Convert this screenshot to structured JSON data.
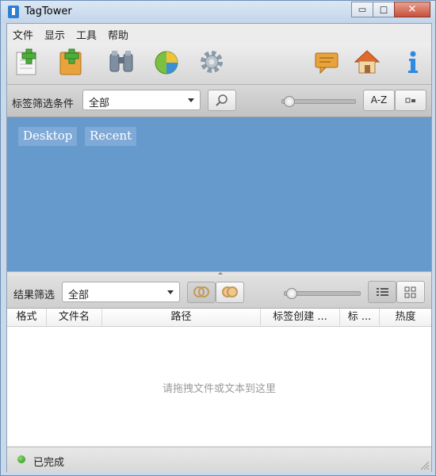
{
  "window": {
    "title": "TagTower",
    "minimize_glyph": "▭",
    "maximize_glyph": "□",
    "close_glyph": "✕"
  },
  "menu": {
    "items": [
      "文件",
      "显示",
      "工具",
      "帮助"
    ]
  },
  "toolbar": {
    "icons": [
      "new-tag-icon",
      "new-tag-group-icon",
      "binoculars-icon",
      "pie-chart-icon",
      "gear-icon",
      "comment-icon",
      "home-icon",
      "info-icon"
    ]
  },
  "tag_filter": {
    "label": "标签筛选条件",
    "select_value": "全部",
    "sort_button": "A-Z",
    "zoom_level": 0.05
  },
  "tags": [
    "Desktop",
    "Recent"
  ],
  "result_filter": {
    "label": "结果筛选",
    "select_value": "全部",
    "zoom_level": 0.05
  },
  "table": {
    "columns": [
      "格式",
      "文件名",
      "路径",
      "标签创建 ...",
      "标 ...",
      "热度"
    ],
    "empty_text": "请拖拽文件或文本到这里"
  },
  "status": {
    "text": "已完成",
    "color": "#3c9a2a"
  },
  "colors": {
    "tag_area": "#6699cc",
    "tag_chip": "#7fa9d6"
  }
}
